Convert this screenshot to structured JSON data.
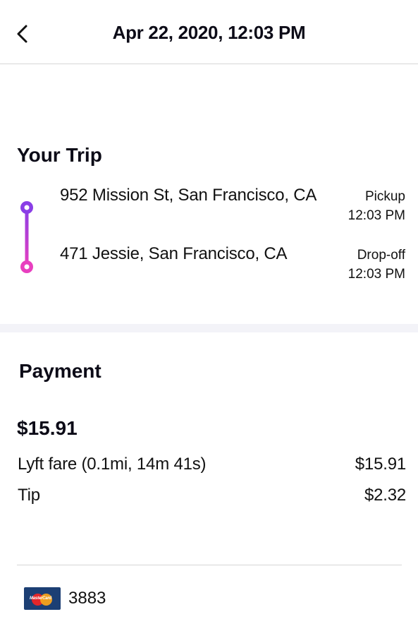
{
  "header": {
    "title": "Apr 22, 2020, 12:03 PM"
  },
  "trip": {
    "section_title": "Your Trip",
    "pickup": {
      "address": "952 Mission St, San Francisco, CA",
      "label": "Pickup",
      "time": "12:03 PM"
    },
    "dropoff": {
      "address": "471 Jessie, San Francisco, CA",
      "label": "Drop-off",
      "time": "12:03 PM"
    },
    "route_colors": {
      "start": "#8a3ee6",
      "end": "#e83fbf"
    }
  },
  "payment": {
    "section_title": "Payment",
    "total": "$15.91",
    "lines": [
      {
        "label": "Lyft fare (0.1mi, 14m 41s)",
        "amount": "$15.91"
      },
      {
        "label": "Tip",
        "amount": "$2.32"
      }
    ],
    "card": {
      "brand": "MasterCard",
      "last4": "3883"
    }
  },
  "icons": {
    "back": "chevron-left-icon",
    "card": "mastercard-icon"
  }
}
